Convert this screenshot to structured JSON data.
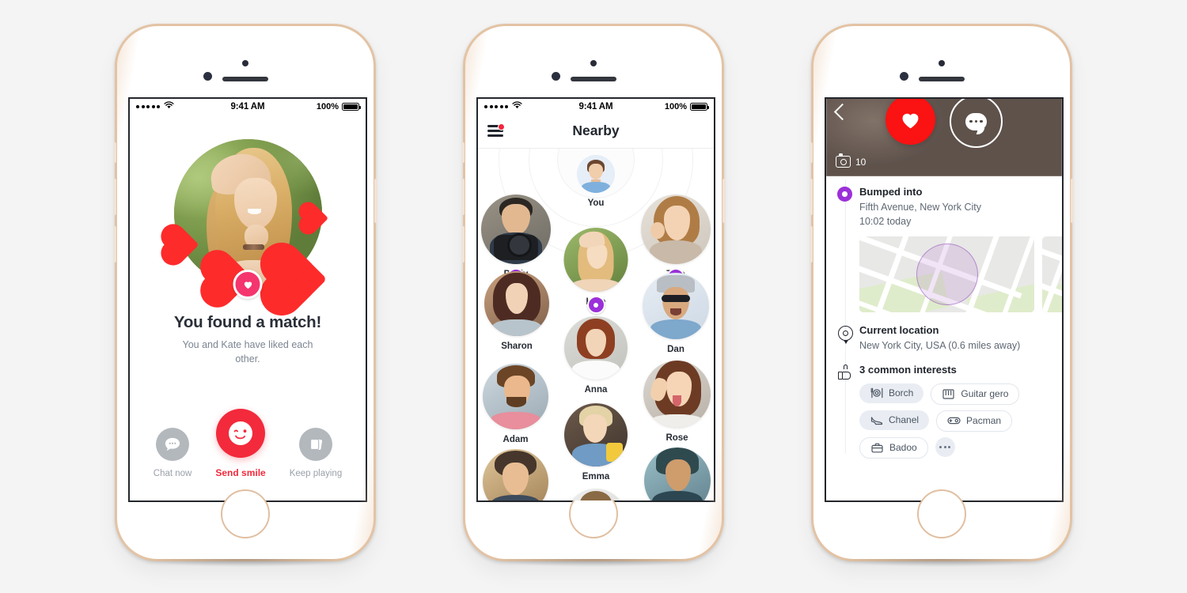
{
  "statusbar": {
    "time": "9:41 AM",
    "battery": "100%"
  },
  "phone1": {
    "screen_name": "match-screen",
    "title": "You found a match!",
    "subtitle": "You and Kate have liked each other.",
    "badge_icon": "heart-icon",
    "actions": [
      {
        "label": "Chat now",
        "icon": "chat-bubble-icon",
        "style": "secondary"
      },
      {
        "label": "Send smile",
        "icon": "wink-smiley-icon",
        "style": "primary"
      },
      {
        "label": "Keep playing",
        "icon": "cards-stack-icon",
        "style": "secondary"
      }
    ],
    "accent_color": "#f22a3c"
  },
  "phone2": {
    "screen_name": "nearby-screen",
    "nav": {
      "title": "Nearby",
      "menu_icon": "hamburger-menu-icon",
      "has_notification": true
    },
    "you_label": "You",
    "people": [
      {
        "name": "Pauly",
        "has_pin": true
      },
      {
        "name": "Tina",
        "has_pin": true
      },
      {
        "name": "Kate",
        "has_pin": true
      },
      {
        "name": "Sharon",
        "has_pin": false
      },
      {
        "name": "Dan",
        "has_pin": false
      },
      {
        "name": "Anna",
        "has_pin": false
      },
      {
        "name": "Adam",
        "has_pin": false
      },
      {
        "name": "Rose",
        "has_pin": false
      },
      {
        "name": "Emma",
        "has_pin": false
      }
    ],
    "pin_color": "#9b30d9"
  },
  "phone3": {
    "screen_name": "profile-screen",
    "back_icon": "back-chevron-icon",
    "photo_count": "10",
    "photo_count_icon": "camera-icon",
    "like_button": {
      "icon": "heart-icon",
      "color": "#fb1212"
    },
    "chat_button": {
      "icon": "chat-bubble-icon"
    },
    "sections": [
      {
        "icon": "map-pin-filled-icon",
        "title": "Bumped into",
        "line1": "Fifth Avenue, New York City",
        "line2": "10:02 today"
      },
      {
        "icon": "map-pin-outline-icon",
        "title": "Current location",
        "line1": "New York City, USA (0.6 miles away)"
      },
      {
        "icon": "thumbs-up-icon",
        "title": "3 common interests"
      }
    ],
    "interests": [
      {
        "label": "Borch",
        "icon": "cutlery-plate-icon",
        "style": "filled"
      },
      {
        "label": "Guitar gero",
        "icon": "piano-keys-icon",
        "style": "outline"
      },
      {
        "label": "Chanel",
        "icon": "high-heel-icon",
        "style": "filled"
      },
      {
        "label": "Pacman",
        "icon": "gamepad-icon",
        "style": "outline"
      },
      {
        "label": "Badoo",
        "icon": "briefcase-icon",
        "style": "outline"
      },
      {
        "label": "",
        "icon": "more-dots-icon",
        "style": "more"
      }
    ]
  }
}
